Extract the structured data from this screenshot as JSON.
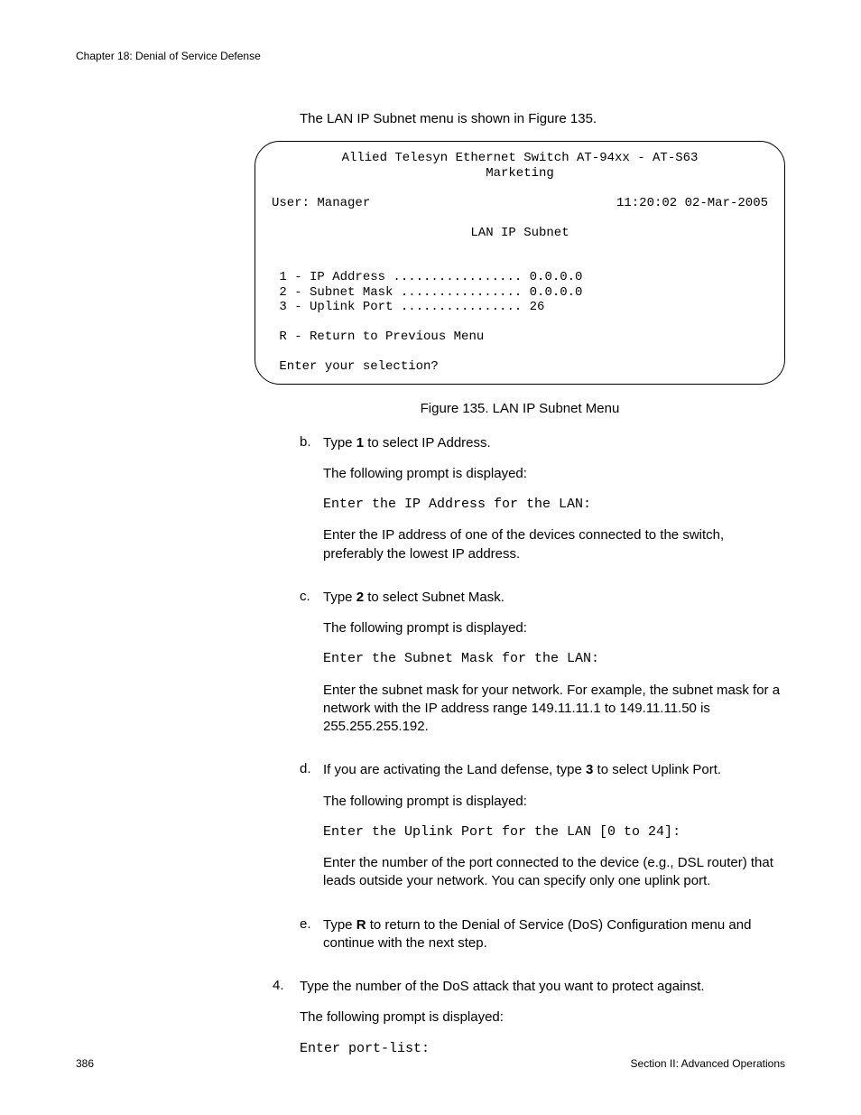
{
  "header": {
    "chapter": "Chapter 18: Denial of Service Defense"
  },
  "intro": "The LAN IP Subnet menu is shown in Figure 135.",
  "terminal": {
    "line1": "Allied Telesyn Ethernet Switch AT-94xx - AT-S63",
    "line2": "Marketing",
    "user": "User: Manager",
    "datetime": "11:20:02 02-Mar-2005",
    "title": "LAN IP Subnet",
    "opt1": "1 - IP Address ................. 0.0.0.0",
    "opt2": "2 - Subnet Mask ................ 0.0.0.0",
    "opt3": "3 - Uplink Port ................ 26",
    "optR": "R - Return to Previous Menu",
    "prompt": "Enter your selection?"
  },
  "figure_caption": "Figure 135. LAN IP Subnet Menu",
  "steps": {
    "b": {
      "label": "b.",
      "line1a": "Type ",
      "line1bold": "1",
      "line1b": " to select IP Address.",
      "line2": "The following prompt is displayed:",
      "code": "Enter the IP Address for the LAN:",
      "line3": "Enter the IP address of one of the devices connected to the switch, preferably the lowest IP address."
    },
    "c": {
      "label": "c.",
      "line1a": "Type ",
      "line1bold": "2",
      "line1b": " to select Subnet Mask.",
      "line2": "The following prompt is displayed:",
      "code": "Enter the Subnet Mask for the LAN:",
      "line3": "Enter the subnet mask for your network. For example, the subnet mask for a network with the IP address range 149.11.11.1 to 149.11.11.50 is 255.255.255.192."
    },
    "d": {
      "label": "d.",
      "line1a": "If you are activating the Land defense, type ",
      "line1bold": "3",
      "line1b": " to select Uplink Port.",
      "line2": "The following prompt is displayed:",
      "code": "Enter the Uplink Port for the LAN [0 to 24]:",
      "line3": "Enter the number of the port connected to the device (e.g., DSL router) that leads outside your network. You can specify only one uplink port."
    },
    "e": {
      "label": "e.",
      "line1a": "Type ",
      "line1bold": "R",
      "line1b": " to return to the Denial of Service (DoS) Configuration menu and continue with the next step."
    }
  },
  "step4": {
    "label": "4.",
    "line1": "Type the number of the DoS attack that you want to protect against.",
    "line2": "The following prompt is displayed:",
    "code": "Enter port-list:"
  },
  "footer": {
    "page": "386",
    "section": "Section II: Advanced Operations"
  }
}
